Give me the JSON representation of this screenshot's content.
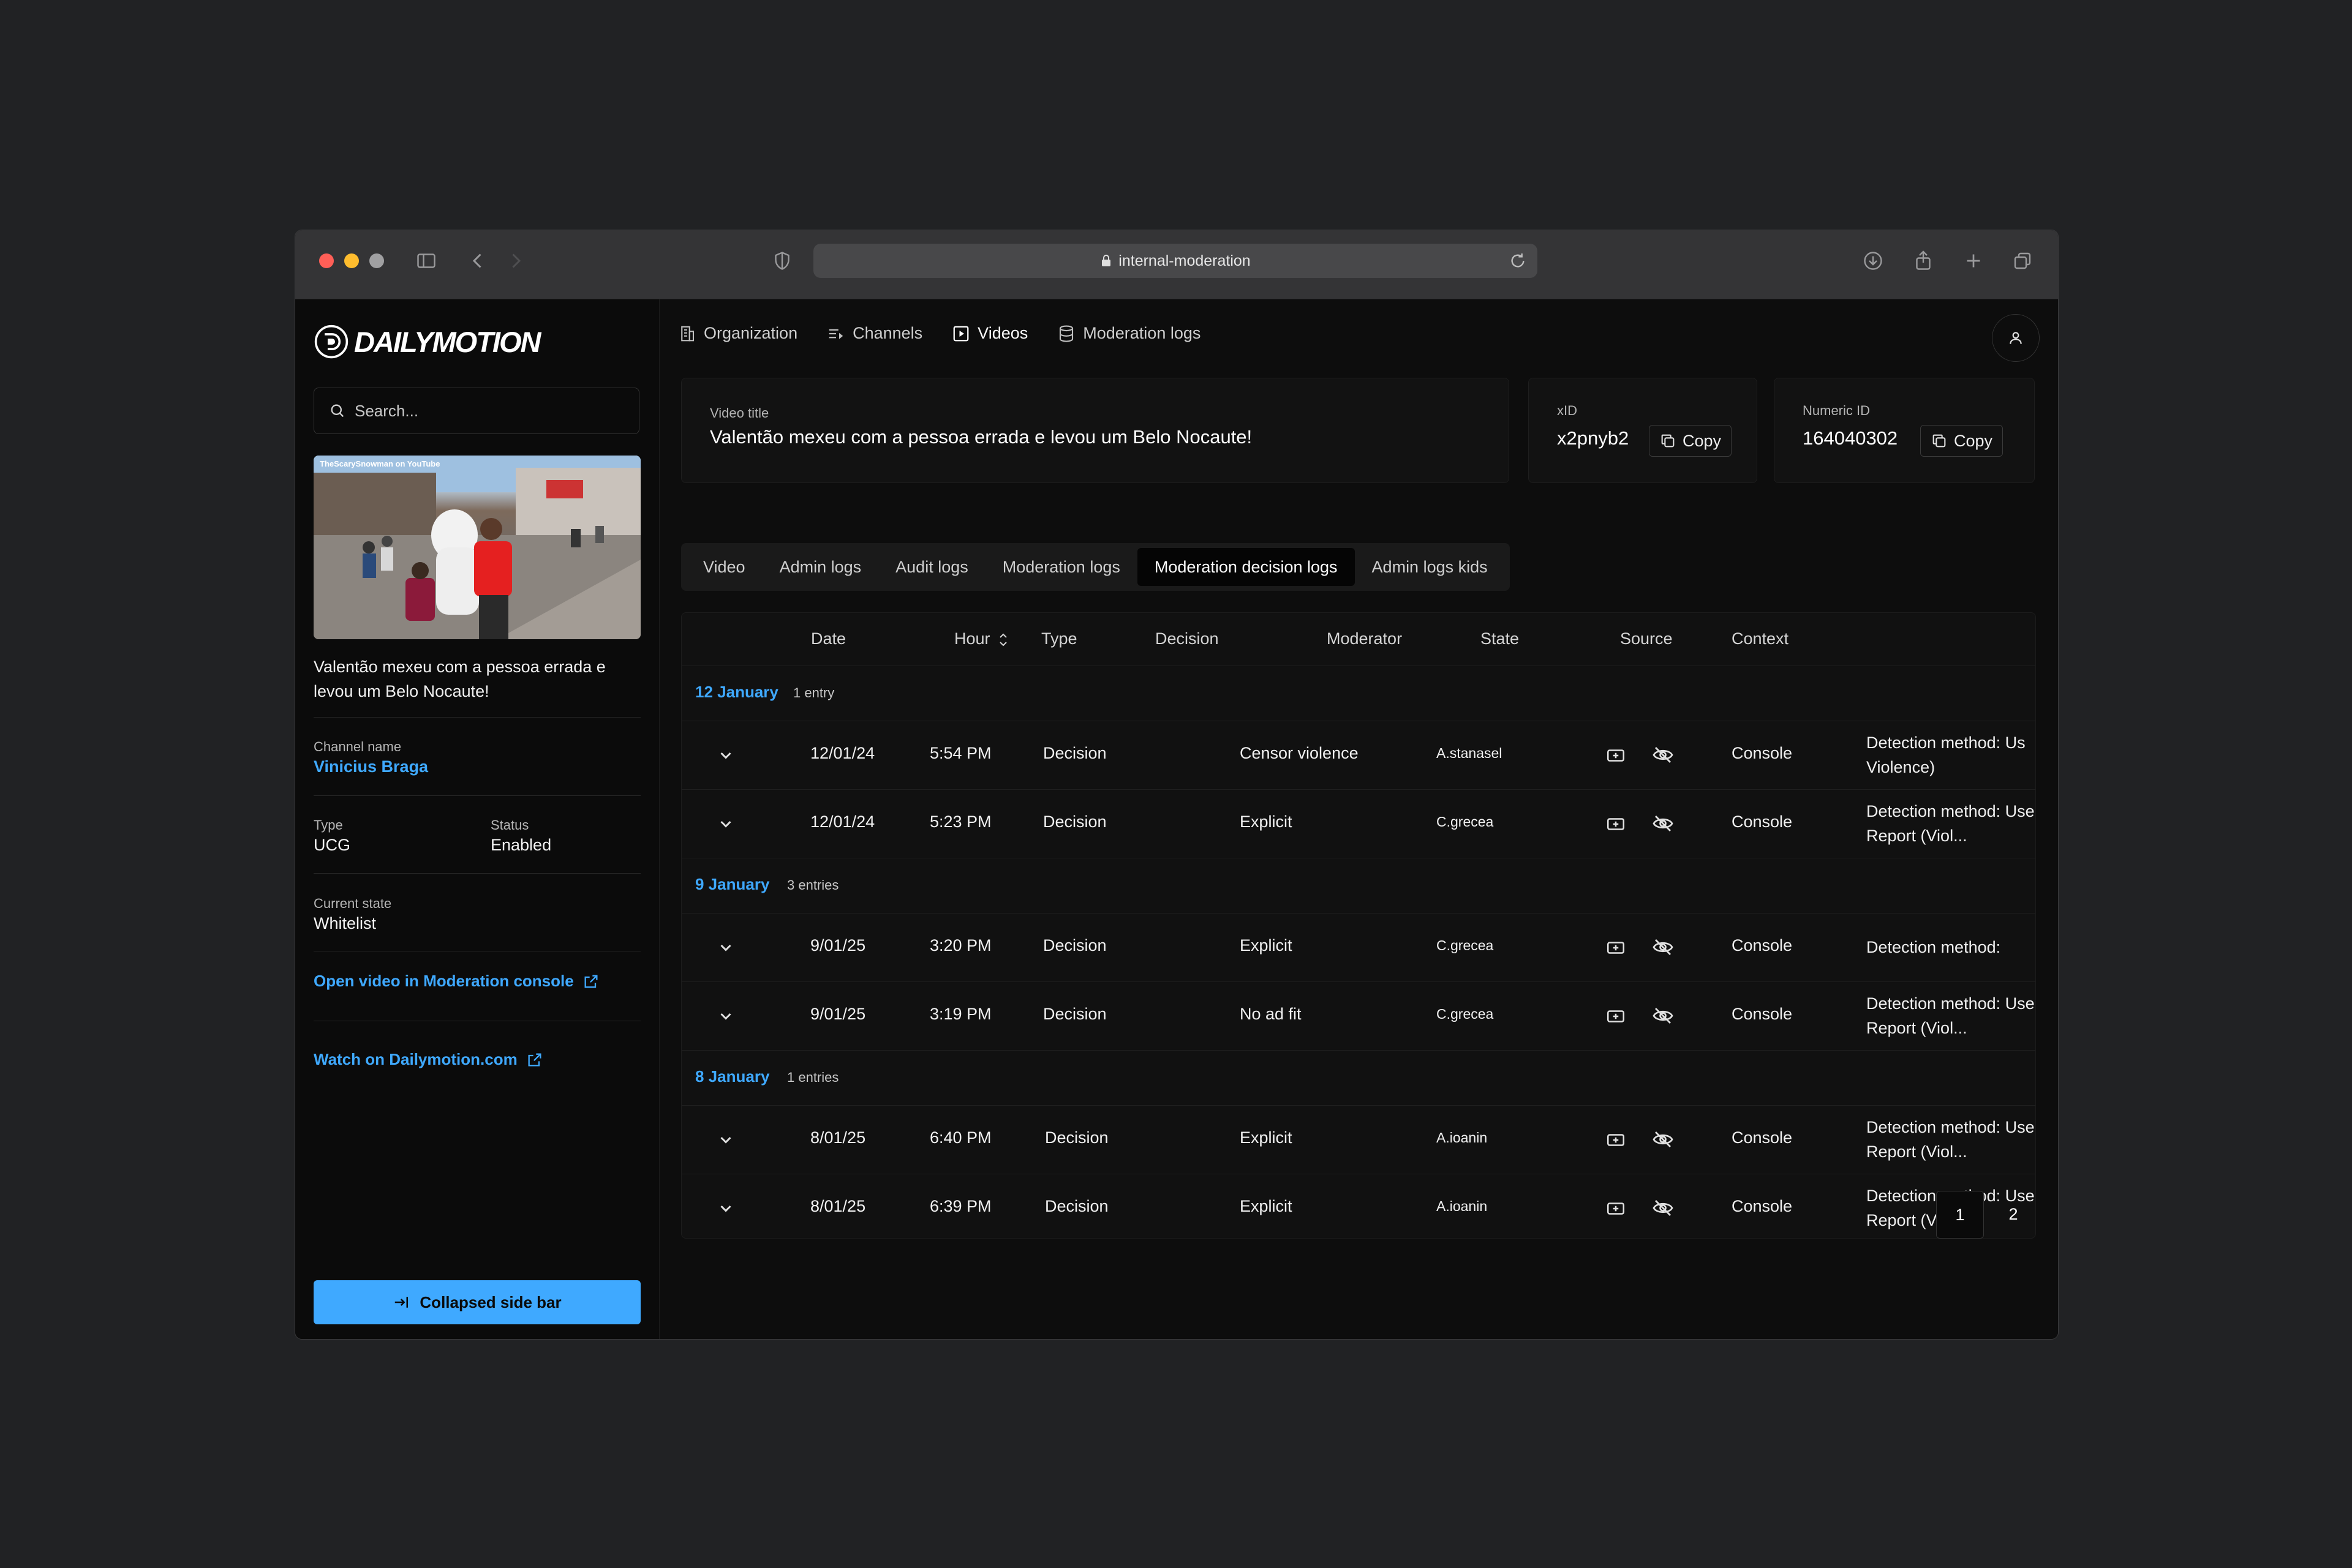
{
  "browser": {
    "url": "internal-moderation"
  },
  "sidebar": {
    "logo_text": "DAILYMOTION",
    "search_placeholder": "Search...",
    "thumbnail_credit": "TheScarySnowman on YouTube",
    "video_title": "Valentão mexeu com a pessoa errada e levou um Belo Nocaute!",
    "channel_label": "Channel name",
    "channel_value": "Vinicius Braga",
    "type_label": "Type",
    "type_value": "UCG",
    "status_label": "Status",
    "status_value": "Enabled",
    "state_label": "Current state",
    "state_value": "Whitelist",
    "open_console_link": "Open video in Moderation console",
    "watch_link": "Watch on Dailymotion.com",
    "collapse_button": "Collapsed side bar"
  },
  "topnav": {
    "items": [
      {
        "label": "Organization",
        "icon": "building-icon"
      },
      {
        "label": "Channels",
        "icon": "list-icon"
      },
      {
        "label": "Videos",
        "icon": "play-square-icon"
      },
      {
        "label": "Moderation logs",
        "icon": "database-icon"
      }
    ],
    "active": "Videos"
  },
  "cards": {
    "title_label": "Video title",
    "title_value": "Valentão mexeu com a pessoa errada e levou um Belo Nocaute!",
    "xid_label": "xID",
    "xid_value": "x2pnyb2",
    "numeric_label": "Numeric ID",
    "numeric_value": "164040302",
    "copy_label": "Copy"
  },
  "tabs": [
    {
      "label": "Video"
    },
    {
      "label": "Admin logs"
    },
    {
      "label": "Audit logs"
    },
    {
      "label": "Moderation logs"
    },
    {
      "label": "Moderation decision logs"
    },
    {
      "label": "Admin logs kids"
    }
  ],
  "active_tab": "Moderation decision logs",
  "table": {
    "headers": {
      "date": "Date",
      "hour": "Hour",
      "type": "Type",
      "decision": "Decision",
      "moderator": "Moderator",
      "state": "State",
      "source": "Source",
      "context": "Context"
    },
    "groups": [
      {
        "date": "12 January",
        "count": "1 entry",
        "rows": [
          {
            "date": "12/01/24",
            "hour": "5:54 PM",
            "type": "Decision",
            "decision": "Censor violence",
            "moderator": "A.stanasel",
            "source": "Console",
            "context": "Detection method: Us Violence)"
          },
          {
            "date": "12/01/24",
            "hour": "5:23 PM",
            "type": "Decision",
            "decision": "Explicit",
            "moderator": "C.grecea",
            "source": "Console",
            "context": "Detection method: User Report (Viol..."
          }
        ]
      },
      {
        "date": "9 January",
        "count": "3 entries",
        "rows": [
          {
            "date": "9/01/25",
            "hour": "3:20 PM",
            "type": "Decision",
            "decision": "Explicit",
            "moderator": "C.grecea",
            "source": "Console",
            "context": "Detection method:"
          },
          {
            "date": "9/01/25",
            "hour": "3:19 PM",
            "type": "Decision",
            "decision": "No ad fit",
            "moderator": "C.grecea",
            "source": "Console",
            "context": "Detection method: User Report (Viol..."
          }
        ]
      },
      {
        "date": "8 January",
        "count": "1 entries",
        "rows": [
          {
            "date": "8/01/25",
            "hour": "6:40 PM",
            "type": "Decision",
            "decision": "Explicit",
            "moderator": "A.ioanin",
            "source": "Console",
            "context": "Detection method: User Report (Viol..."
          },
          {
            "date": "8/01/25",
            "hour": "6:39 PM",
            "type": "Decision",
            "decision": "Explicit",
            "moderator": "A.ioanin",
            "source": "Console",
            "context": "Detection method: User Report (Viol..."
          }
        ]
      }
    ]
  },
  "pagination": {
    "pages": [
      "1",
      "2"
    ],
    "current": "1"
  },
  "colors": {
    "accent": "#3fa9ff",
    "background": "#0d0d0d",
    "desktop": "#212224"
  }
}
